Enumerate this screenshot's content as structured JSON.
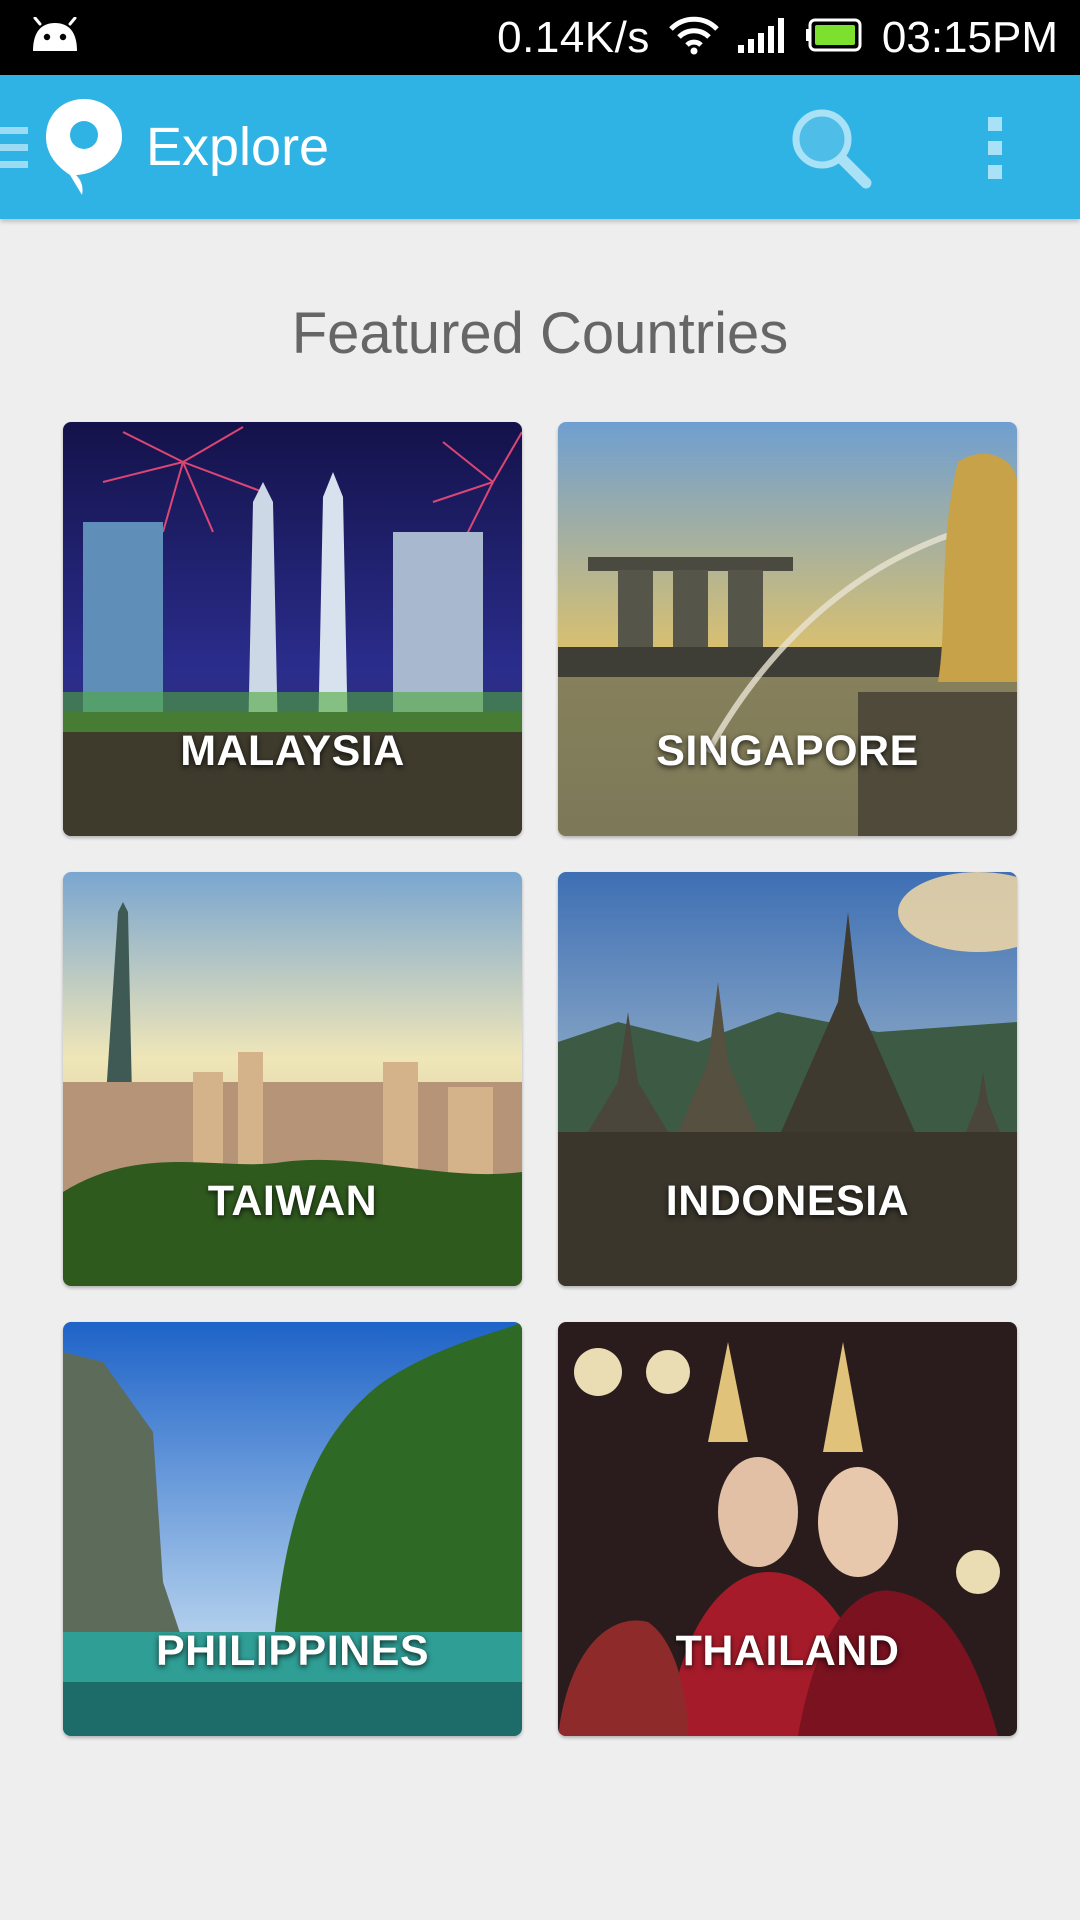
{
  "status_bar": {
    "net_speed": "0.14K/s",
    "time": "03:15PM",
    "icons": [
      "android-icon",
      "wifi-icon",
      "signal-icon",
      "battery-icon"
    ]
  },
  "app_bar": {
    "title": "Explore",
    "icons": [
      "drawer-icon",
      "location-pin-icon",
      "search-icon",
      "overflow-menu-icon"
    ],
    "color": "#2fb3e4"
  },
  "section": {
    "title": "Featured Countries"
  },
  "countries": [
    {
      "name": "MALAYSIA"
    },
    {
      "name": "SINGAPORE"
    },
    {
      "name": "TAIWAN"
    },
    {
      "name": "INDONESIA"
    },
    {
      "name": "PHILIPPINES"
    },
    {
      "name": "THAILAND"
    }
  ]
}
